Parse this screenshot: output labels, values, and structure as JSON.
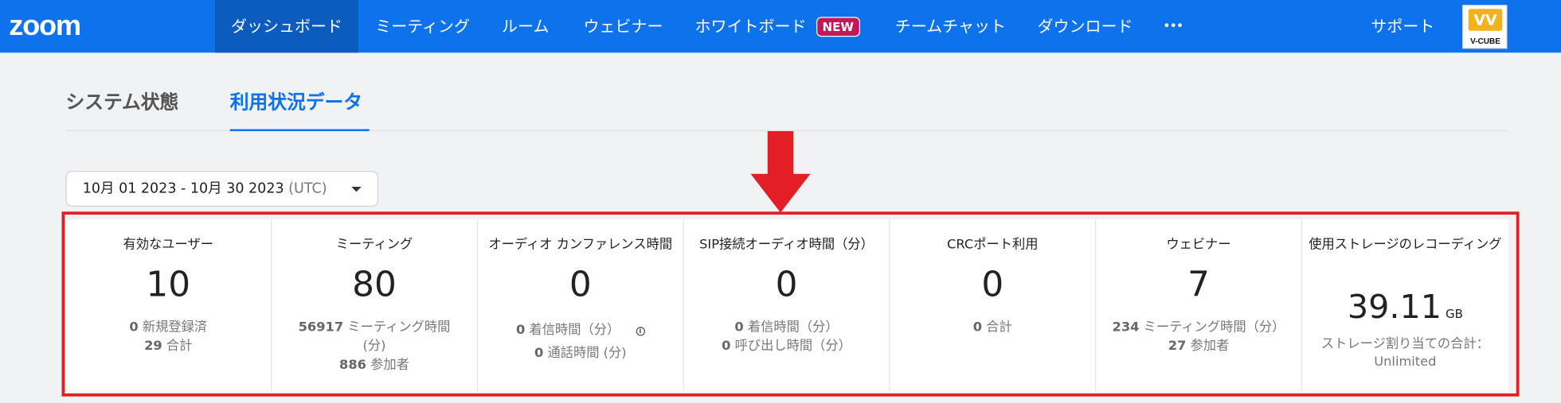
{
  "nav": {
    "logo": "zoom",
    "items": [
      "ダッシュボード",
      "ミーティング",
      "ルーム",
      "ウェビナー",
      "ホワイトボード",
      "チームチャット",
      "ダウンロード",
      "•••"
    ],
    "badge_new": "NEW",
    "support": "サポート",
    "avatar_mark": "VV",
    "avatar_text": "V-CUBE"
  },
  "tabs": [
    "システム状態",
    "利用状況データ"
  ],
  "date_range": {
    "value": "10月 01 2023 - 10月 30 2023",
    "tz": "(UTC)"
  },
  "stats": [
    {
      "label": "有効なユーザー",
      "value": "10",
      "lines": [
        [
          "0",
          "新規登録済"
        ],
        [
          "29",
          "合計"
        ]
      ]
    },
    {
      "label": "ミーティング",
      "value": "80",
      "lines": [
        [
          "56917",
          "ミーティング時間"
        ],
        [
          "",
          "(分)"
        ],
        [
          "886",
          "参加者"
        ]
      ]
    },
    {
      "label": "オーディオ カンファレンス時間",
      "value": "0",
      "lines": [
        [
          "0",
          "着信時間（分）"
        ],
        [
          "0",
          "通話時間 (分)"
        ]
      ]
    },
    {
      "label": "SIP接続オーディオ時間（分）",
      "value": "0",
      "lines": [
        [
          "0",
          "着信時間（分）"
        ],
        [
          "0",
          "呼び出し時間（分）"
        ]
      ]
    },
    {
      "label": "CRCポート利用",
      "value": "0",
      "lines": [
        [
          "0",
          "合計"
        ]
      ]
    },
    {
      "label": "ウェビナー",
      "value": "7",
      "lines": [
        [
          "234",
          "ミーティング時間（分）"
        ],
        [
          "27",
          "参加者"
        ]
      ]
    },
    {
      "label": "使用ストレージのレコーディング",
      "value": "39.11",
      "unit": "GB",
      "lines": [
        [
          "",
          "ストレージ割り当ての合計："
        ],
        [
          "",
          "Unlimited"
        ]
      ]
    }
  ],
  "colors": {
    "nav_bg": "#0e72ed",
    "nav_active": "#0b5cbe",
    "accent": "#0e72ed",
    "highlight": "#e31e24",
    "badge": "#c2185b"
  }
}
